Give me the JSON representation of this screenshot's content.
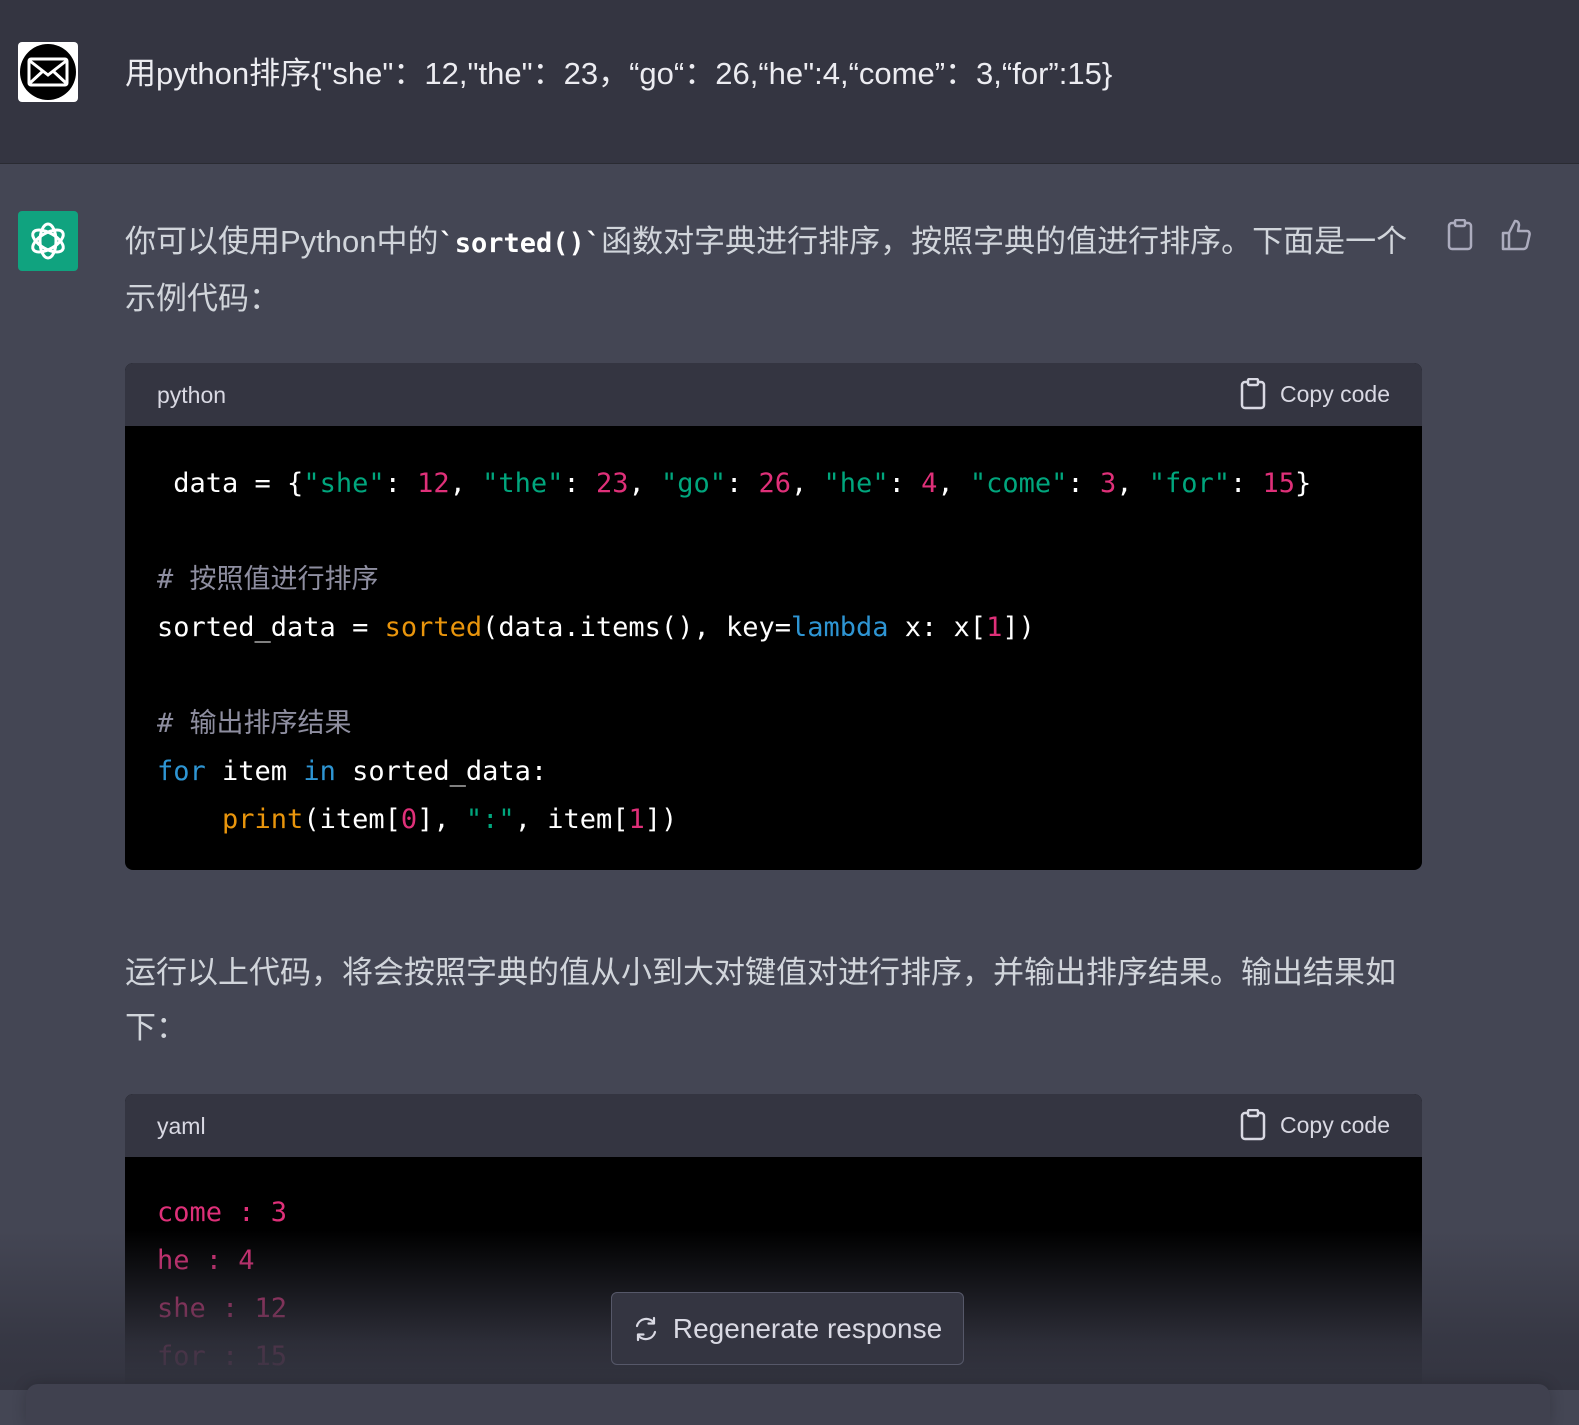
{
  "user_message": {
    "text": "用python排序{\"she\"：12,\"the\"：23，“go“：26,“he\":4,“come”：3,“for”:15}"
  },
  "assistant_message": {
    "intro_before": "你可以使用Python中的",
    "intro_code": "`sorted()`",
    "intro_after": "函数对字典进行排序，按照字典的值进行排序。下面是一个示例代码：",
    "code_block_1": {
      "language": "python",
      "copy_label": "Copy code"
    },
    "middle_text": "运行以上代码，将会按照字典的值从小到大对键值对进行排序，并输出排序结果。输出结果如下：",
    "code_block_2": {
      "language": "yaml",
      "copy_label": "Copy code",
      "lines": [
        "come : 3",
        "he : 4",
        "she : 12",
        "for : 15"
      ]
    }
  },
  "regenerate_label": "Regenerate response",
  "icons": {
    "user_avatar": "envelope-icon",
    "assistant_avatar": "openai-logo-icon",
    "copy": "clipboard-icon",
    "thumbs_up": "thumbs-up-icon",
    "regenerate": "refresh-icon"
  },
  "colors": {
    "string": "#00a67d",
    "number": "#df3079",
    "builtin": "#e9950c",
    "keyword": "#2e95d3",
    "comment": "#8e8ea0",
    "brand": "#10a37f"
  }
}
